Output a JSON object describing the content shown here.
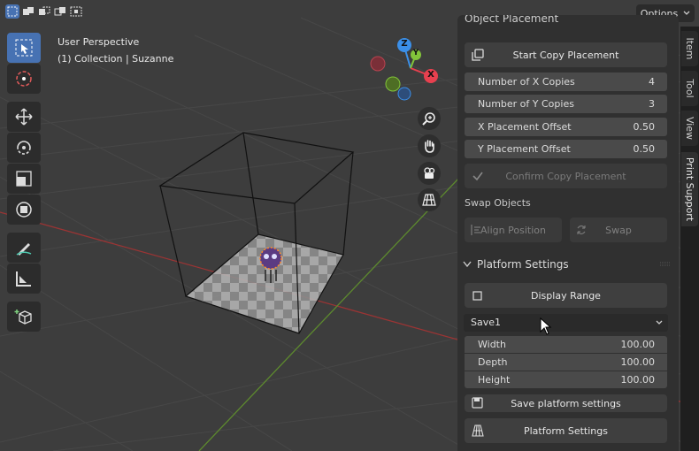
{
  "header": {
    "selection_modes": [
      "select-new-icon",
      "select-extend-icon",
      "select-subtract-icon",
      "select-invert-icon",
      "select-intersect-icon"
    ],
    "options_label": "Options"
  },
  "viewport": {
    "perspective_label": "User Perspective",
    "collection_label": "(1) Collection | Suzanne"
  },
  "gizmo": {
    "axis_x": "X",
    "axis_y": "Y",
    "axis_z": "Z"
  },
  "panel": {
    "header_partial": "Object Placement",
    "start_copy": "Start Copy Placement",
    "fields": [
      {
        "label": "Number of X Copies",
        "value": "4"
      },
      {
        "label": "Number of Y Copies",
        "value": "3"
      },
      {
        "label": "X Placement Offset",
        "value": "0.50"
      },
      {
        "label": "Y Placement Offset",
        "value": "0.50"
      }
    ],
    "confirm_copy": "Confirm Copy Placement",
    "swap_objects_label": "Swap Objects",
    "align_position": "Align Position",
    "swap": "Swap",
    "platform_settings_header": "Platform Settings",
    "display_range": "Display Range",
    "preset_selected": "Save1",
    "dims": [
      {
        "label": "Width",
        "value": "100.00"
      },
      {
        "label": "Depth",
        "value": "100.00"
      },
      {
        "label": "Height",
        "value": "100.00"
      }
    ],
    "save_platform": "Save platform settings",
    "platform_settings_btn": "Platform Settings"
  },
  "tabs": {
    "item": "Item",
    "tool": "Tool",
    "view": "View",
    "print_support": "Print Support"
  },
  "colors": {
    "accent": "#4772b3",
    "axis_x": "#e8404f",
    "axis_y": "#82c43a",
    "axis_z": "#3b8fe8"
  }
}
